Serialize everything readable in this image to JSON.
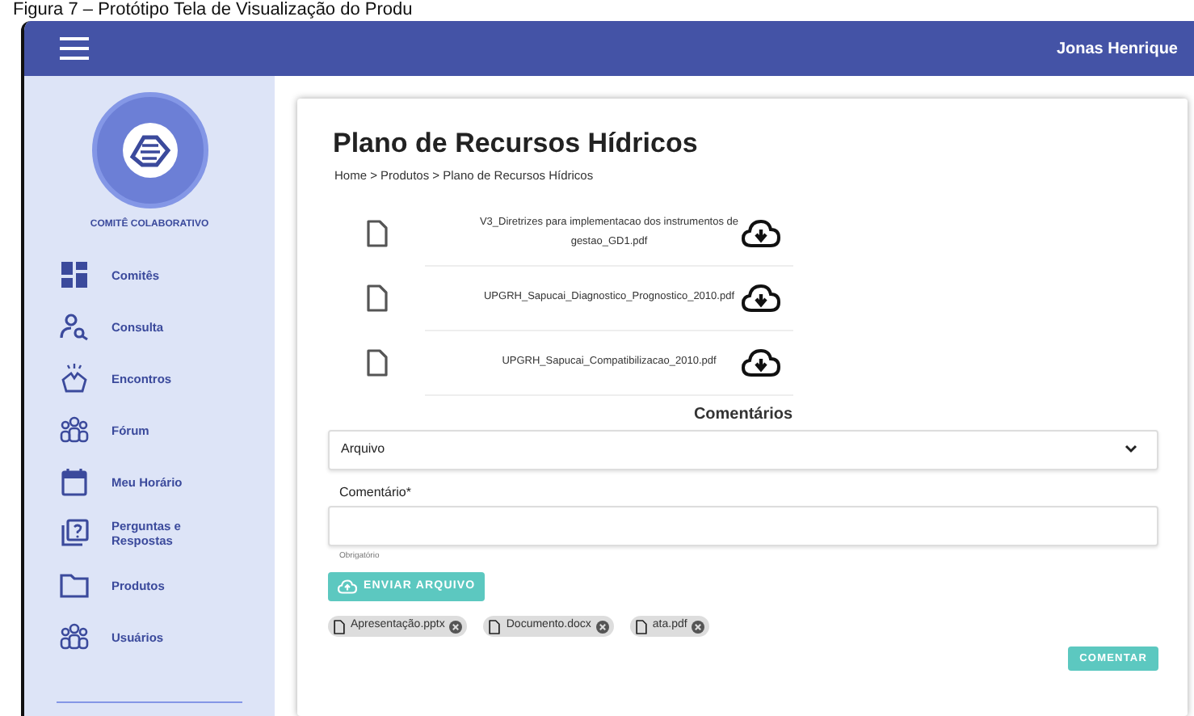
{
  "caption": "Figura 7 – Protótipo Tela de Visualização do Produ",
  "top_bar": {
    "user_name": "Jonas Henrique"
  },
  "sidebar": {
    "logo_text": "COMITÊ COLABORATIVO",
    "items": [
      {
        "label": "Comitês",
        "kind": "grid"
      },
      {
        "label": "Consulta",
        "kind": "person-search"
      },
      {
        "label": "Encontros",
        "kind": "hands"
      },
      {
        "label": "Fórum",
        "kind": "group"
      },
      {
        "label": "Meu Horário",
        "kind": "calendar"
      },
      {
        "label": "Perguntas e Respostas",
        "kind": "question"
      },
      {
        "label": "Produtos",
        "kind": "folder"
      },
      {
        "label": "Usuários",
        "kind": "group"
      }
    ]
  },
  "page": {
    "title": "Plano de Recursos Hídricos",
    "breadcrumb": "Home > Produtos > Plano de Recursos Hídricos",
    "files": [
      {
        "name": "V3_Diretrizes para implementacao dos instrumentos de gestao_GD1.pdf"
      },
      {
        "name": "UPGRH_Sapucai_Diagnostico_Prognostico_2010.pdf"
      },
      {
        "name": "UPGRH_Sapucai_Compatibilizacao_2010.pdf"
      }
    ],
    "comments": {
      "heading": "Comentários",
      "select_value": "Arquivo",
      "comment_label": "Comentário*",
      "helper": "Obrigatório",
      "upload_button": "ENVIAR ARQUIVO",
      "attachments": [
        {
          "name": "Apresentação.pptx"
        },
        {
          "name": "Documento.docx"
        },
        {
          "name": "ata.pdf"
        }
      ],
      "submit_button": "COMENTAR"
    }
  }
}
